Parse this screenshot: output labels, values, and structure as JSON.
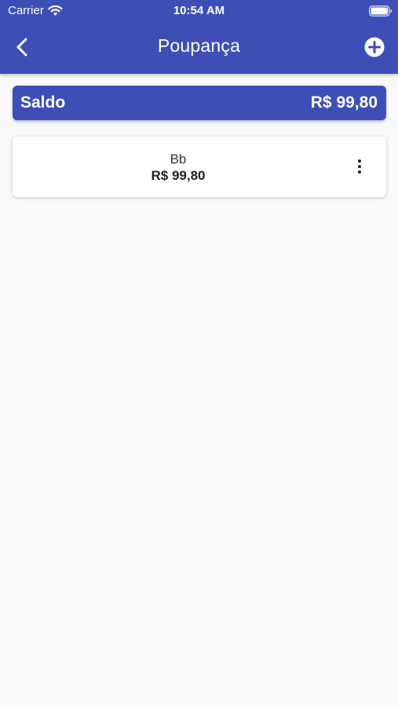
{
  "status_bar": {
    "carrier": "Carrier",
    "time": "10:54 AM",
    "icons": [
      "wifi-icon",
      "battery-icon"
    ]
  },
  "app_bar": {
    "title": "Poupança",
    "back_icon": "chevron-left-icon",
    "add_icon": "plus-circle-icon",
    "background_color": "#3d4fb6"
  },
  "balance": {
    "label": "Saldo",
    "value": "R$ 99,80"
  },
  "accounts": [
    {
      "name": "Bb",
      "balance": "R$ 99,80",
      "menu_icon": "more-vertical-icon"
    }
  ],
  "colors": {
    "primary": "#3d4fb6",
    "background": "#f9f9f9",
    "card": "#ffffff"
  }
}
